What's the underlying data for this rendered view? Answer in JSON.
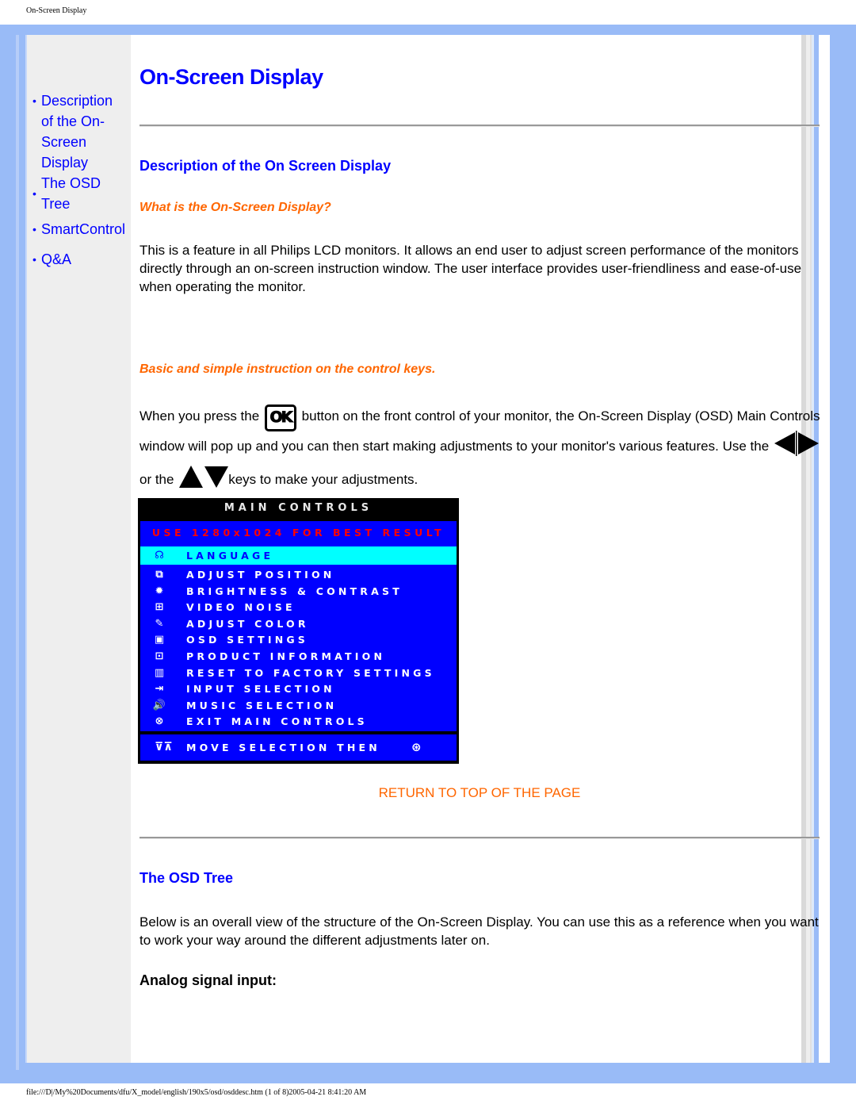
{
  "print_header": "On-Screen Display",
  "print_footer": "file:///D|/My%20Documents/dfu/X_model/english/190x5/osd/osddesc.htm (1 of 8)2005-04-21 8:41:20 AM",
  "sidebar": {
    "items": [
      {
        "label_lines": [
          "Description",
          "of the On-",
          "Screen",
          "Display"
        ]
      },
      {
        "label_lines": [
          "The OSD",
          "Tree"
        ]
      },
      {
        "label_lines": [
          "SmartControl"
        ]
      },
      {
        "label_lines": [
          "Q&A"
        ]
      }
    ]
  },
  "page_title": "On-Screen Display",
  "section1": {
    "heading": "Description of the On Screen Display",
    "subheading1": "What is the On-Screen Display?",
    "paragraph1": "This is a feature in all Philips LCD monitors. It allows an end user to adjust screen performance of the monitors directly through an on-screen instruction window. The user interface provides user-friendliness and ease-of-use when operating the monitor.",
    "subheading2": "Basic and simple instruction on the control keys.",
    "instr_part1": "When you press the",
    "ok_label": "OK",
    "instr_part2": "button on the front control of your monitor, the On-Screen Display (OSD) Main Controls window will pop up and you can then start making adjustments to your monitor's various features. Use the",
    "instr_part3": "or the",
    "instr_part4": "keys to make your adjustments."
  },
  "osd": {
    "title": "MAIN CONTROLS",
    "hint": "USE 1280x1024 FOR BEST RESULT",
    "items": [
      {
        "icon": "language-icon",
        "glyph": "☊",
        "label": "LANGUAGE",
        "selected": true
      },
      {
        "icon": "adjust-position-icon",
        "glyph": "⧉",
        "label": "ADJUST POSITION",
        "selected": false
      },
      {
        "icon": "brightness-icon",
        "glyph": "✹",
        "label": "BRIGHTNESS & CONTRAST",
        "selected": false
      },
      {
        "icon": "video-noise-icon",
        "glyph": "⊞",
        "label": "VIDEO NOISE",
        "selected": false
      },
      {
        "icon": "palette-icon",
        "glyph": "✎",
        "label": "ADJUST COLOR",
        "selected": false
      },
      {
        "icon": "osd-settings-icon",
        "glyph": "▣",
        "label": "OSD SETTINGS",
        "selected": false
      },
      {
        "icon": "product-info-icon",
        "glyph": "⊡",
        "label": "PRODUCT INFORMATION",
        "selected": false
      },
      {
        "icon": "factory-reset-icon",
        "glyph": "▥",
        "label": "RESET TO FACTORY SETTINGS",
        "selected": false
      },
      {
        "icon": "input-selection-icon",
        "glyph": "⇥",
        "label": "INPUT SELECTION",
        "selected": false
      },
      {
        "icon": "speaker-icon",
        "glyph": "🔊",
        "label": "MUSIC SELECTION",
        "selected": false
      },
      {
        "icon": "exit-icon",
        "glyph": "⊗",
        "label": "EXIT MAIN CONTROLS",
        "selected": false
      }
    ],
    "footer_label": "MOVE SELECTION THEN",
    "footer_left_glyph": "⊽⊼",
    "footer_right_glyph": "⊛"
  },
  "return_link": "RETURN TO TOP OF THE PAGE",
  "section2": {
    "heading": "The OSD Tree",
    "paragraph": "Below is an overall view of the structure of the On-Screen Display. You can use this as a reference when you want to work your way around the different adjustments later on.",
    "subheading": "Analog signal input:"
  },
  "colors": {
    "link_blue": "#0000ff",
    "accent_orange": "#ff6600",
    "frame_blue": "#99bbf7",
    "osd_blue": "#0000ff",
    "osd_highlight": "#00ffff",
    "osd_hint_red": "#ff0000"
  }
}
